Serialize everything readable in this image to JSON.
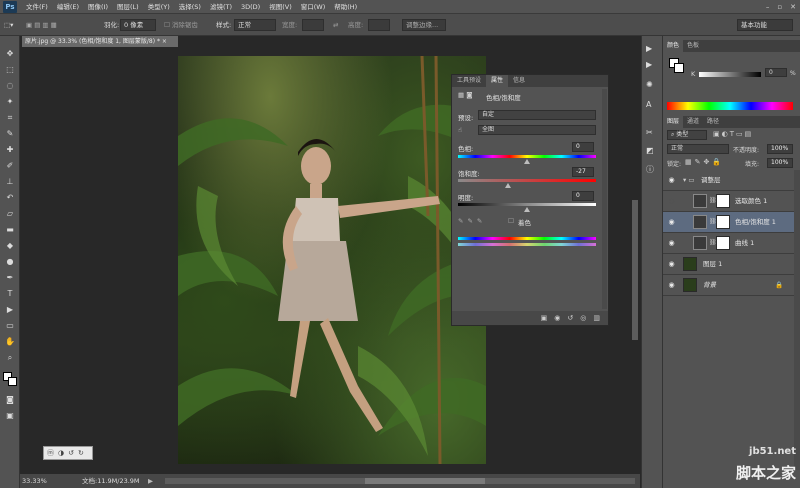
{
  "app": {
    "logo": "Ps",
    "menu": [
      "文件(F)",
      "编辑(E)",
      "图像(I)",
      "图层(L)",
      "类型(Y)",
      "选择(S)",
      "滤镜(T)",
      "3D(D)",
      "视图(V)",
      "窗口(W)",
      "帮助(H)"
    ],
    "win_min": "–",
    "win_max": "▫",
    "win_close": "✕"
  },
  "options": {
    "feather_label": "羽化:",
    "feather_value": "0 像素",
    "antialias": "消除锯齿",
    "style_label": "样式:",
    "style_value": "正常",
    "width_label": "宽度:",
    "height_label": "高度:",
    "refine": "调整边缘...",
    "workspace": "基本功能"
  },
  "document": {
    "tab_title": "原片.jpg @ 33.3% (色相/饱和度 1, 图层蒙版/8) *",
    "close": "×",
    "zoom": "33.33%",
    "doc_size": "文档:11.9M/23.9M"
  },
  "mini_toolbar": [
    "ⓜ",
    "◑",
    "↺",
    "↻"
  ],
  "properties": {
    "tabs": [
      "工具预设",
      "属性",
      "信息"
    ],
    "title": "色相/饱和度",
    "preset_label": "预设:",
    "preset_value": "自定",
    "channel_value": "全图",
    "hue_label": "色相:",
    "hue_value": "0",
    "sat_label": "饱和度:",
    "sat_value": "-27",
    "light_label": "明度:",
    "light_value": "0",
    "colorize": "着色",
    "hue_pos": 0.5,
    "sat_pos": 0.365,
    "light_pos": 0.5
  },
  "color_panel": {
    "tabs": [
      "颜色",
      "色板"
    ],
    "k_label": "K",
    "k_value": "0",
    "pct": "%"
  },
  "layers_panel": {
    "tabs": [
      "图层",
      "通道",
      "路径"
    ],
    "kind_label": "⌕ 类型",
    "blend": "正常",
    "opacity_label": "不透明度:",
    "opacity_value": "100%",
    "lock_label": "锁定:",
    "fill_label": "填充:",
    "fill_value": "100%",
    "layers": [
      {
        "name": "调整层",
        "type": "group",
        "visible": true
      },
      {
        "name": "选取颜色 1",
        "type": "adjust",
        "visible": false
      },
      {
        "name": "色相/饱和度 1",
        "type": "adjust",
        "visible": true,
        "selected": true
      },
      {
        "name": "曲线 1",
        "type": "adjust",
        "visible": true
      },
      {
        "name": "图层 1",
        "type": "pixel",
        "visible": true
      },
      {
        "name": "背景",
        "type": "background",
        "visible": true
      }
    ]
  },
  "watermark": {
    "line1": "jb51.net",
    "line2": "脚本之家"
  },
  "colors": {
    "panel": "#535353",
    "dark": "#282828",
    "selected": "#5d6b80"
  }
}
